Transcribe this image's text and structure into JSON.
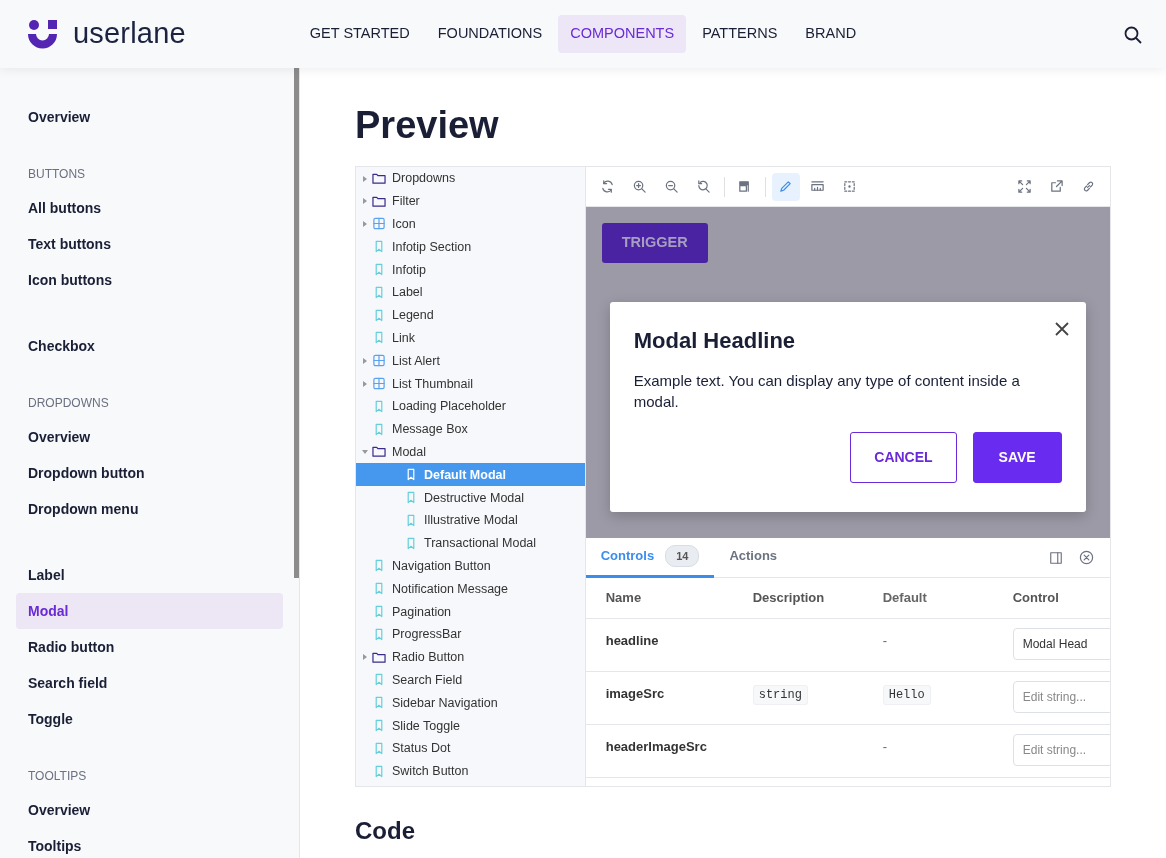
{
  "header": {
    "logo_text": "userlane",
    "nav": [
      {
        "label": "GET STARTED",
        "selected": false
      },
      {
        "label": "FOUNDATIONS",
        "selected": false
      },
      {
        "label": "COMPONENTS",
        "selected": true
      },
      {
        "label": "PATTERNS",
        "selected": false
      },
      {
        "label": "BRAND",
        "selected": false
      }
    ]
  },
  "sidebar": {
    "sections": [
      {
        "items": [
          {
            "label": "Overview",
            "selected": false
          }
        ]
      },
      {
        "heading": "BUTTONS",
        "items": [
          {
            "label": "All buttons",
            "selected": false
          },
          {
            "label": "Text buttons",
            "selected": false
          },
          {
            "label": "Icon buttons",
            "selected": false
          }
        ]
      },
      {
        "items": [
          {
            "label": "Checkbox",
            "selected": false
          }
        ]
      },
      {
        "heading": "DROPDOWNS",
        "items": [
          {
            "label": "Overview",
            "selected": false
          },
          {
            "label": "Dropdown button",
            "selected": false
          },
          {
            "label": "Dropdown menu",
            "selected": false
          }
        ]
      },
      {
        "items": [
          {
            "label": "Label",
            "selected": false
          },
          {
            "label": "Modal",
            "selected": true
          },
          {
            "label": "Radio button",
            "selected": false
          },
          {
            "label": "Search field",
            "selected": false
          },
          {
            "label": "Toggle",
            "selected": false
          }
        ]
      },
      {
        "heading": "TOOLTIPS",
        "items": [
          {
            "label": "Overview",
            "selected": false
          },
          {
            "label": "Tooltips",
            "selected": false
          }
        ]
      }
    ]
  },
  "main": {
    "title": "Preview",
    "code_title": "Code",
    "tree": [
      {
        "kind": "folder",
        "label": "Dropdowns",
        "expanded": false,
        "selected": false
      },
      {
        "kind": "folder",
        "label": "Filter",
        "expanded": false,
        "selected": false
      },
      {
        "kind": "component",
        "label": "Icon",
        "expanded": false,
        "selected": false
      },
      {
        "kind": "story",
        "label": "Infotip Section",
        "selected": false
      },
      {
        "kind": "story",
        "label": "Infotip",
        "selected": false
      },
      {
        "kind": "story",
        "label": "Label",
        "selected": false
      },
      {
        "kind": "story",
        "label": "Legend",
        "selected": false
      },
      {
        "kind": "story",
        "label": "Link",
        "selected": false
      },
      {
        "kind": "component",
        "label": "List Alert",
        "expanded": false,
        "selected": false
      },
      {
        "kind": "component",
        "label": "List Thumbnail",
        "expanded": false,
        "selected": false
      },
      {
        "kind": "story",
        "label": "Loading Placeholder",
        "selected": false
      },
      {
        "kind": "story",
        "label": "Message Box",
        "selected": false
      },
      {
        "kind": "folder",
        "label": "Modal",
        "expanded": true,
        "selected": false,
        "children": [
          {
            "kind": "story",
            "label": "Default Modal",
            "selected": true
          },
          {
            "kind": "story",
            "label": "Destructive Modal",
            "selected": false
          },
          {
            "kind": "story",
            "label": "Illustrative Modal",
            "selected": false
          },
          {
            "kind": "story",
            "label": "Transactional Modal",
            "selected": false
          }
        ]
      },
      {
        "kind": "story",
        "label": "Navigation Button",
        "selected": false
      },
      {
        "kind": "story",
        "label": "Notification Message",
        "selected": false
      },
      {
        "kind": "story",
        "label": "Pagination",
        "selected": false
      },
      {
        "kind": "story",
        "label": "ProgressBar",
        "selected": false
      },
      {
        "kind": "folder",
        "label": "Radio Button",
        "expanded": false,
        "selected": false
      },
      {
        "kind": "story",
        "label": "Search Field",
        "selected": false
      },
      {
        "kind": "story",
        "label": "Sidebar Navigation",
        "selected": false
      },
      {
        "kind": "story",
        "label": "Slide Toggle",
        "selected": false
      },
      {
        "kind": "story",
        "label": "Status Dot",
        "selected": false
      },
      {
        "kind": "story",
        "label": "Switch Button",
        "selected": false
      }
    ],
    "toolbar": {
      "left": [
        {
          "kind": "reload",
          "selected": false
        },
        {
          "kind": "zoom-in",
          "selected": false
        },
        {
          "kind": "zoom-out",
          "selected": false
        },
        {
          "kind": "zoom-reset",
          "selected": false
        },
        {
          "kind": "background",
          "selected": false
        },
        {
          "kind": "pen",
          "selected": true
        },
        {
          "kind": "ruler",
          "selected": false
        },
        {
          "kind": "outline",
          "selected": false
        }
      ],
      "right": [
        {
          "kind": "fullscreen",
          "selected": false
        },
        {
          "kind": "new-tab",
          "selected": false
        },
        {
          "kind": "link",
          "selected": false
        }
      ]
    },
    "canvas": {
      "trigger": "TRIGGER",
      "modal": {
        "headline": "Modal Headline",
        "text": "Example text. You can display any type of content inside a modal.",
        "cancel": "CANCEL",
        "save": "SAVE"
      }
    },
    "addons": {
      "tabs": [
        {
          "label": "Controls",
          "count": "14",
          "selected": true
        },
        {
          "label": "Actions",
          "selected": false
        }
      ],
      "columns": [
        "Name",
        "Description",
        "Default",
        "Control"
      ],
      "rows": [
        {
          "name": "headline",
          "default": "-",
          "control_value": "Modal Head"
        },
        {
          "name": "imageSrc",
          "description": "string",
          "default_code": "Hello",
          "control_placeholder": "Edit string..."
        },
        {
          "name": "headerImageSrc",
          "default": "-",
          "control_placeholder": "Edit string..."
        }
      ]
    }
  }
}
